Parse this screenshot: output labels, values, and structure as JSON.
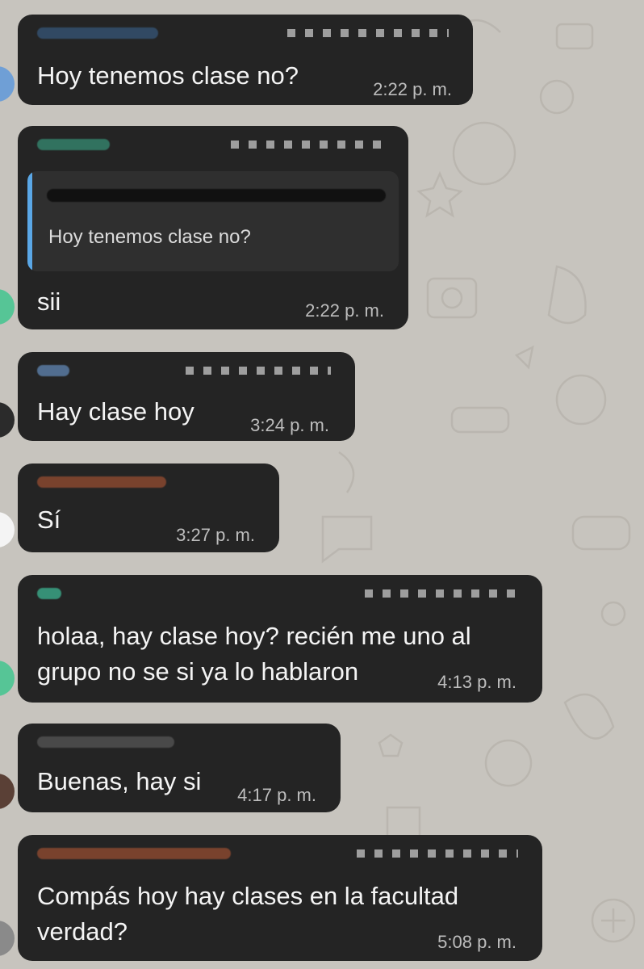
{
  "colors": {
    "background": "#c7c4be",
    "bubble": "#242424",
    "reply_accent": "#5aa7e6",
    "sender_green": "#3fbf9a",
    "sender_orange": "#e0673a"
  },
  "messages": [
    {
      "text": "Hoy tenemos clase no?",
      "time": "2:22 p. m."
    },
    {
      "reply_quote": "Hoy tenemos clase no?",
      "text": "sii",
      "time": "2:22 p. m."
    },
    {
      "text": "Hay clase hoy",
      "time": "3:24 p. m."
    },
    {
      "text": "Sí",
      "time": "3:27 p. m."
    },
    {
      "text": "holaa, hay clase hoy? recién me uno al\ngrupo no se si ya lo hablaron",
      "time": "4:13 p. m."
    },
    {
      "text": "Buenas, hay si",
      "time": "4:17 p. m."
    },
    {
      "text": "Compás hoy hay clases en la facultad\nverdad?",
      "time": "5:08 p. m."
    }
  ]
}
